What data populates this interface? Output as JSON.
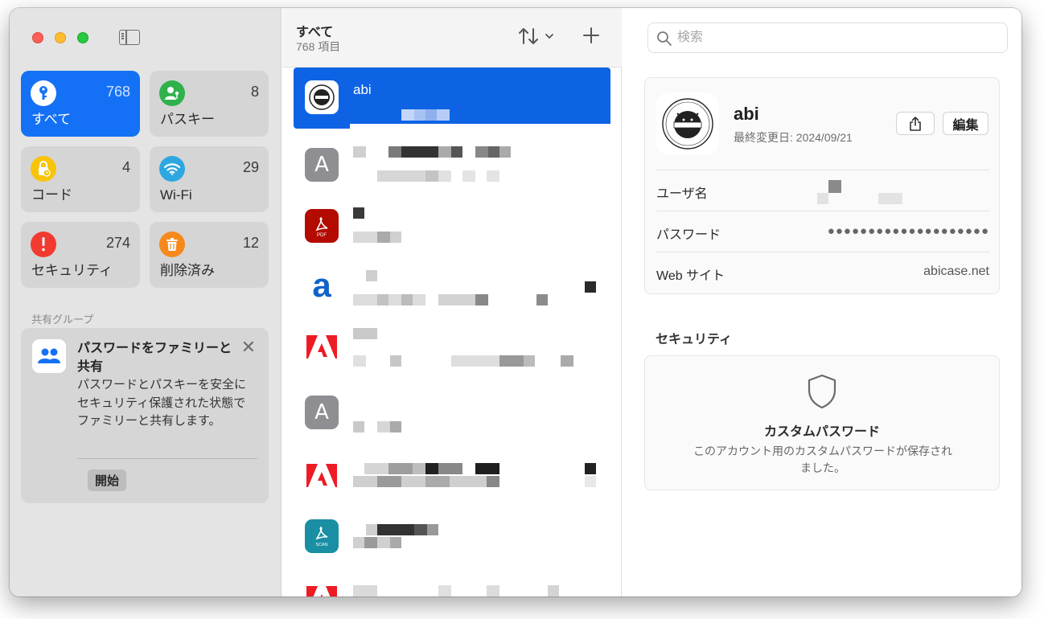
{
  "sidebar": {
    "categories": [
      {
        "label": "すべて",
        "count": "768",
        "icon": "key-icon",
        "color": "#1471f5"
      },
      {
        "label": "パスキー",
        "count": "8",
        "icon": "person-key-icon",
        "color": "#2fb24c"
      },
      {
        "label": "コード",
        "count": "4",
        "icon": "lock-clock-icon",
        "color": "#f7c40a"
      },
      {
        "label": "Wi-Fi",
        "count": "29",
        "icon": "wifi-icon",
        "color": "#2ea7e0"
      },
      {
        "label": "セキュリティ",
        "count": "274",
        "icon": "alert-icon",
        "color": "#f23a30"
      },
      {
        "label": "削除済み",
        "count": "12",
        "icon": "trash-icon",
        "color": "#f7891c"
      }
    ],
    "group_title": "共有グループ",
    "family": {
      "title": "パスワードをファミリーと共有",
      "description": "パスワードとパスキーを安全にセキュリティ保護された状態でファミリーと共有します。",
      "start_label": "開始"
    }
  },
  "list": {
    "title": "すべて",
    "count": "768 項目",
    "selected_title": "abi"
  },
  "detail": {
    "search_placeholder": "検索",
    "account": {
      "name": "abi",
      "modified": "最終変更日: 2024/09/21",
      "edit_label": "編集"
    },
    "fields": {
      "username_label": "ユーザ名",
      "password_label": "パスワード",
      "password_value": "●●●●●●●●●●●●●●●●●●●●",
      "website_label": "Web サイト",
      "website_value": "abicase.net"
    },
    "security": {
      "title": "セキュリティ",
      "heading": "カスタムパスワード",
      "description": "このアカウント用のカスタムパスワードが保存されました。"
    }
  }
}
